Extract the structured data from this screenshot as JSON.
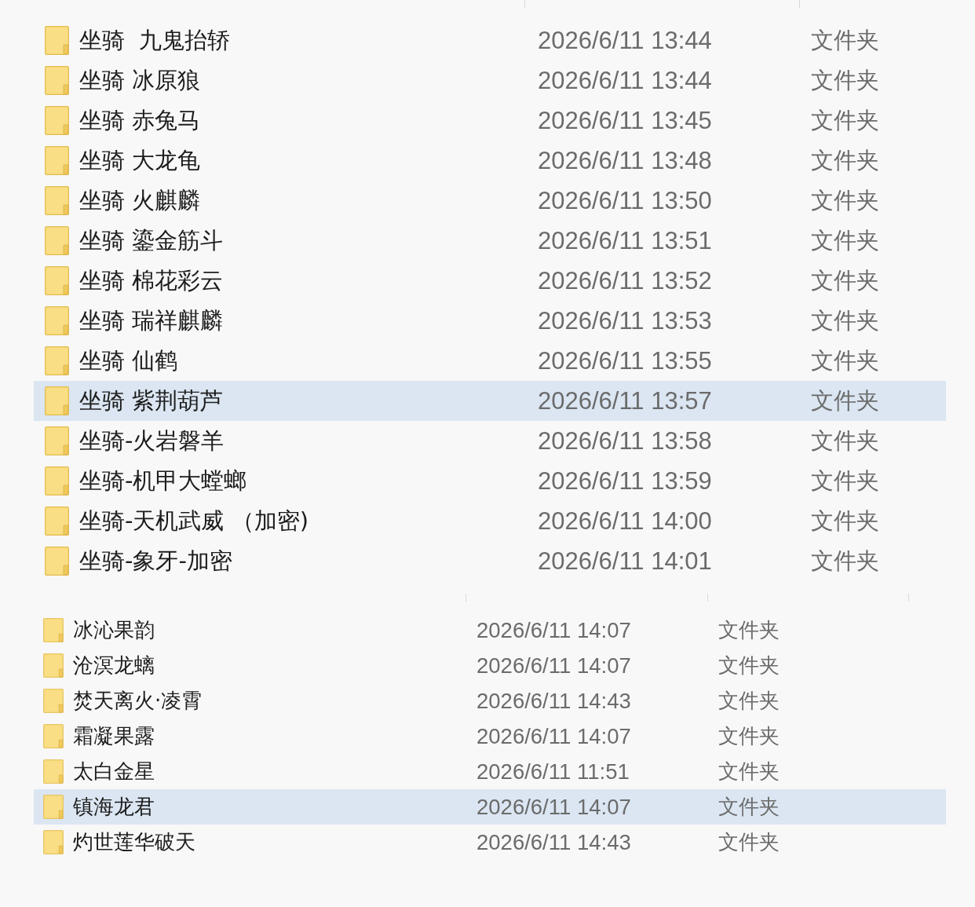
{
  "panes": [
    {
      "rows": [
        {
          "name": "坐骑  九鬼抬轿",
          "modified": "2026/6/11 13:44",
          "type": "文件夹",
          "selected": false
        },
        {
          "name": "坐骑 冰原狼",
          "modified": "2026/6/11 13:44",
          "type": "文件夹",
          "selected": false
        },
        {
          "name": "坐骑 赤兔马",
          "modified": "2026/6/11 13:45",
          "type": "文件夹",
          "selected": false
        },
        {
          "name": "坐骑 大龙龟",
          "modified": "2026/6/11 13:48",
          "type": "文件夹",
          "selected": false
        },
        {
          "name": "坐骑 火麒麟",
          "modified": "2026/6/11 13:50",
          "type": "文件夹",
          "selected": false
        },
        {
          "name": "坐骑 鎏金筋斗",
          "modified": "2026/6/11 13:51",
          "type": "文件夹",
          "selected": false
        },
        {
          "name": "坐骑 棉花彩云",
          "modified": "2026/6/11 13:52",
          "type": "文件夹",
          "selected": false
        },
        {
          "name": "坐骑 瑞祥麒麟",
          "modified": "2026/6/11 13:53",
          "type": "文件夹",
          "selected": false
        },
        {
          "name": "坐骑 仙鹤",
          "modified": "2026/6/11 13:55",
          "type": "文件夹",
          "selected": false
        },
        {
          "name": "坐骑 紫荆葫芦",
          "modified": "2026/6/11 13:57",
          "type": "文件夹",
          "selected": true
        },
        {
          "name": "坐骑-火岩磐羊",
          "modified": "2026/6/11 13:58",
          "type": "文件夹",
          "selected": false
        },
        {
          "name": "坐骑-机甲大螳螂",
          "modified": "2026/6/11 13:59",
          "type": "文件夹",
          "selected": false
        },
        {
          "name": "坐骑-天机武威 （加密)",
          "modified": "2026/6/11 14:00",
          "type": "文件夹",
          "selected": false
        },
        {
          "name": "坐骑-象牙-加密",
          "modified": "2026/6/11 14:01",
          "type": "文件夹",
          "selected": false
        }
      ]
    },
    {
      "rows": [
        {
          "name": "冰沁果韵",
          "modified": "2026/6/11 14:07",
          "type": "文件夹",
          "selected": false
        },
        {
          "name": "沧溟龙螭",
          "modified": "2026/6/11 14:07",
          "type": "文件夹",
          "selected": false
        },
        {
          "name": "焚天离火·凌霄",
          "modified": "2026/6/11 14:43",
          "type": "文件夹",
          "selected": false
        },
        {
          "name": "霜凝果露",
          "modified": "2026/6/11 14:07",
          "type": "文件夹",
          "selected": false
        },
        {
          "name": "太白金星",
          "modified": "2026/6/11 11:51",
          "type": "文件夹",
          "selected": false
        },
        {
          "name": "镇海龙君",
          "modified": "2026/6/11 14:07",
          "type": "文件夹",
          "selected": true
        },
        {
          "name": "灼世莲华破天",
          "modified": "2026/6/11 14:43",
          "type": "文件夹",
          "selected": false
        }
      ]
    }
  ]
}
